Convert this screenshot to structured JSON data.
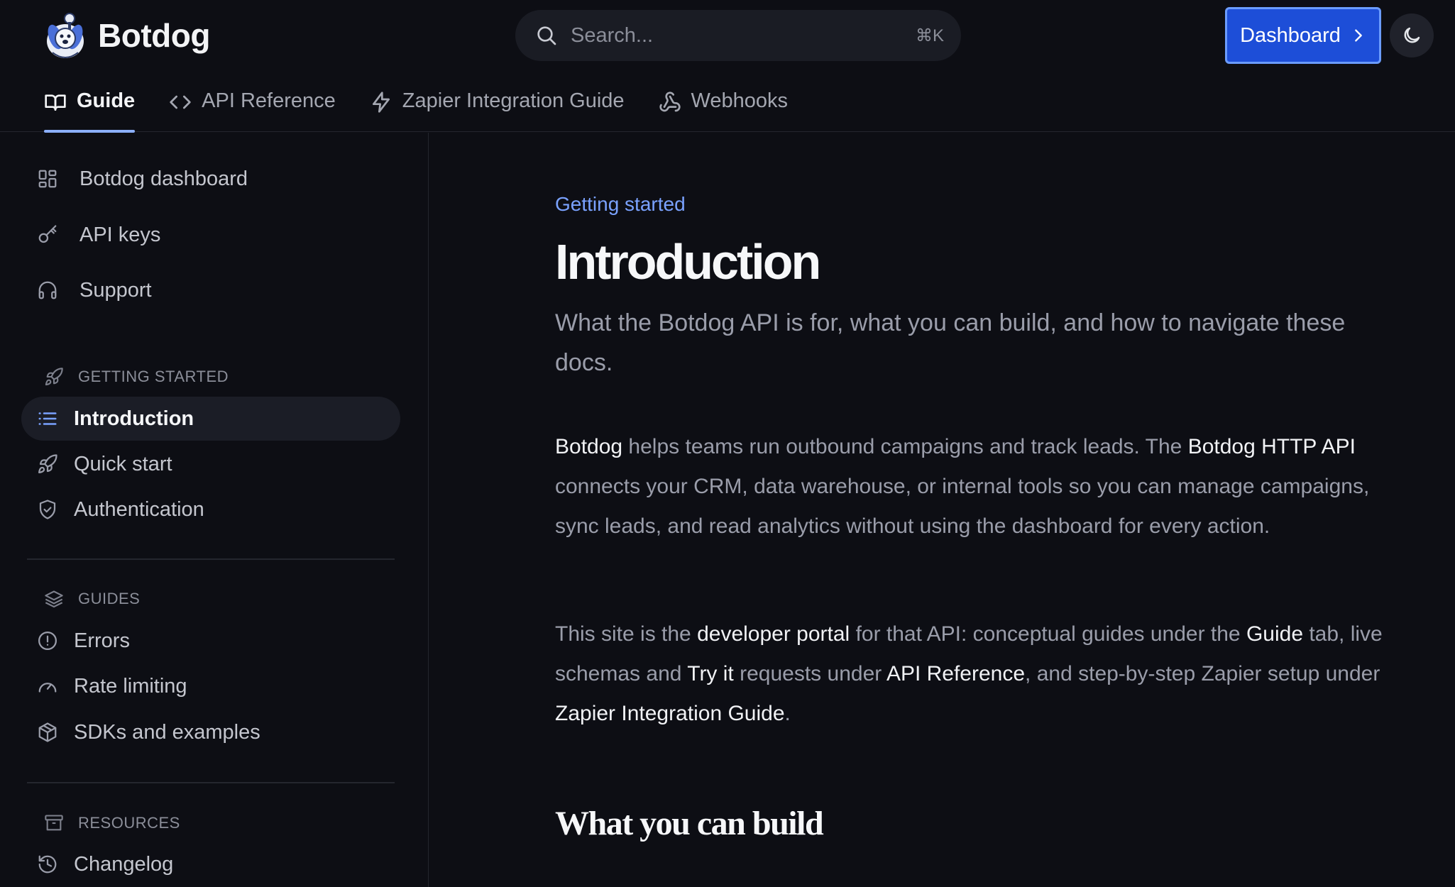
{
  "app": {
    "name": "Botdog"
  },
  "header": {
    "search_placeholder": "Search...",
    "search_shortcut": "⌘K",
    "dashboard_label": "Dashboard",
    "accent_color": "#1d4ed8"
  },
  "tabs": [
    {
      "label": "Guide",
      "icon": "book-open-icon",
      "active": true
    },
    {
      "label": "API Reference",
      "icon": "code-icon",
      "active": false
    },
    {
      "label": "Zapier Integration Guide",
      "icon": "lightning-icon",
      "active": false
    },
    {
      "label": "Webhooks",
      "icon": "webhook-icon",
      "active": false
    }
  ],
  "sidebar": {
    "top_links": [
      {
        "label": "Botdog dashboard",
        "icon": "grid-icon"
      },
      {
        "label": "API keys",
        "icon": "key-icon"
      },
      {
        "label": "Support",
        "icon": "headphones-icon"
      }
    ],
    "sections": [
      {
        "title": "GETTING STARTED",
        "icon": "rocket-icon",
        "items": [
          {
            "label": "Introduction",
            "icon": "list-icon",
            "active": true
          },
          {
            "label": "Quick start",
            "icon": "rocket-icon"
          },
          {
            "label": "Authentication",
            "icon": "shield-icon"
          }
        ]
      },
      {
        "title": "GUIDES",
        "icon": "layers-icon",
        "items": [
          {
            "label": "Errors",
            "icon": "alert-circle-icon"
          },
          {
            "label": "Rate limiting",
            "icon": "gauge-icon"
          },
          {
            "label": "SDKs and examples",
            "icon": "package-icon"
          }
        ]
      },
      {
        "title": "RESOURCES",
        "icon": "archive-icon",
        "items": [
          {
            "label": "Changelog",
            "icon": "history-icon"
          }
        ]
      }
    ]
  },
  "main": {
    "eyebrow": "Getting started",
    "title": "Introduction",
    "subtitle": "What the Botdog API is for, what you can build, and how to navigate these docs.",
    "paragraph1": [
      {
        "text": "Botdog",
        "strong": true
      },
      {
        "text": " helps teams run outbound campaigns and track leads. The ",
        "strong": false
      },
      {
        "text": "Botdog HTTP API",
        "strong": true
      },
      {
        "text": " connects your CRM, data warehouse, or internal tools so you can manage campaigns, sync leads, and read analytics without using the dashboard for every action.",
        "strong": false
      }
    ],
    "paragraph2": [
      {
        "text": "This site is the ",
        "strong": false
      },
      {
        "text": "developer portal",
        "strong": true
      },
      {
        "text": " for that API: conceptual guides under the ",
        "strong": false
      },
      {
        "text": "Guide",
        "strong": true
      },
      {
        "text": " tab, live schemas and ",
        "strong": false
      },
      {
        "text": "Try it",
        "strong": true
      },
      {
        "text": " requests under ",
        "strong": false
      },
      {
        "text": "API Reference",
        "strong": true
      },
      {
        "text": ", and step-by-step Zapier setup under ",
        "strong": false
      },
      {
        "text": "Zapier Integration Guide",
        "strong": true
      },
      {
        "text": ".",
        "strong": false
      }
    ],
    "heading2": "What you can build"
  }
}
